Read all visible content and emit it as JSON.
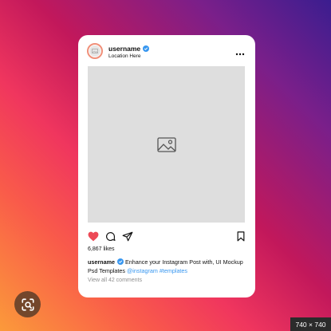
{
  "post": {
    "username": "username",
    "location": "Location Here",
    "likes": "6,867 likes",
    "caption_username": "username",
    "caption_text": " Enhance your Instagram Post with, UI Mockup Psd Templates ",
    "caption_tags": "@instagram #templates",
    "comments": "View all 42 comments"
  },
  "icons": {
    "verified": "verified-badge-icon",
    "more": "more-options-icon",
    "image": "image-placeholder-icon",
    "like": "heart-icon",
    "comment": "comment-icon",
    "share": "share-icon",
    "save": "bookmark-icon",
    "lens": "visual-search-icon"
  },
  "colors": {
    "like": "#ed4956",
    "verified": "#3897f0",
    "link": "#3897f0"
  },
  "overlay": {
    "dimensions": "740 × 740"
  }
}
